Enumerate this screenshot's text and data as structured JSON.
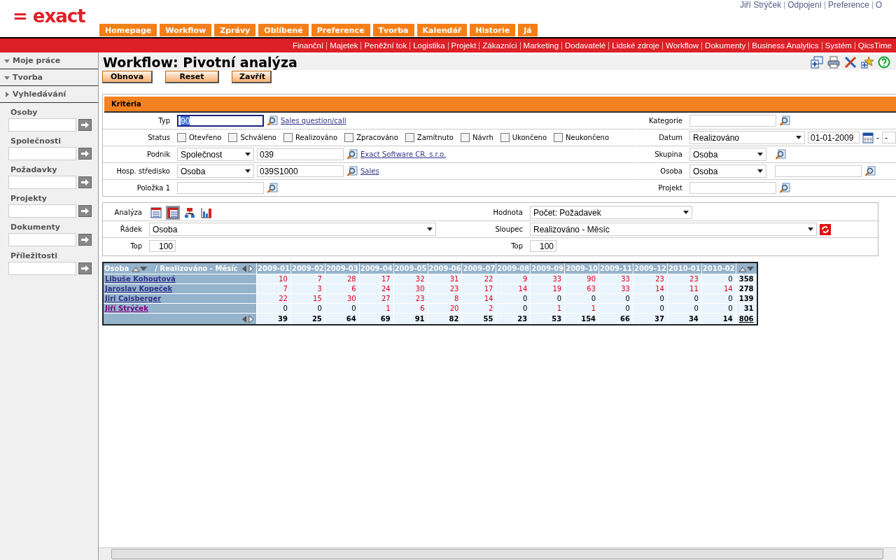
{
  "logo": "= exact",
  "user_links": [
    "Jiří Strýček",
    "Odpojení",
    "Preference",
    "O"
  ],
  "main_tabs": [
    {
      "label": "Homepage",
      "selected": false
    },
    {
      "label": "Workflow",
      "selected": false
    },
    {
      "label": "Zprávy",
      "selected": false
    },
    {
      "label": "Oblíbené",
      "selected": false
    },
    {
      "label": "Preference",
      "selected": false
    },
    {
      "label": "Tvorba",
      "selected": false
    },
    {
      "label": "Kalendář",
      "selected": false
    },
    {
      "label": "Historie",
      "selected": false
    },
    {
      "label": "Já",
      "selected": false
    }
  ],
  "module_links": [
    "Finanční",
    "Majetek",
    "Peněžní tok",
    "Logistika",
    "Projekt",
    "Zákazníci",
    "Marketing",
    "Dodavatelé",
    "Lidské zdroje",
    "Workflow",
    "Dokumenty",
    "Business Analytics",
    "Systém",
    "QicsTime"
  ],
  "sidebar": {
    "sections": [
      {
        "label": "Moje práce",
        "expanded": true
      },
      {
        "label": "Tvorba",
        "expanded": true
      },
      {
        "label": "Vyhledávání",
        "expanded": false
      }
    ],
    "searches": [
      "Osoby",
      "Společnosti",
      "Požadavky",
      "Projekty",
      "Dokumenty",
      "Příležitosti"
    ]
  },
  "page_title": "Workflow: Pivotní analýza",
  "buttons": [
    "Obnova",
    "Reset",
    "Zavřít"
  ],
  "criteria": {
    "title": "Kritéria",
    "typ": {
      "label": "Typ",
      "value": "90",
      "link": "Sales question/call"
    },
    "status": {
      "label": "Status",
      "options": [
        {
          "label": "Otevřeno",
          "checked": false
        },
        {
          "label": "Schváleno",
          "checked": false
        },
        {
          "label": "Realizováno",
          "checked": false
        },
        {
          "label": "Zpracováno",
          "checked": false
        },
        {
          "label": "Zamítnuto",
          "checked": false
        },
        {
          "label": "Návrh",
          "checked": false
        },
        {
          "label": "Ukončeno",
          "checked": false
        },
        {
          "label": "Neukončeno",
          "checked": false
        }
      ]
    },
    "podnik": {
      "label": "Podnik",
      "select": "Společnost",
      "value": "039",
      "link": "Exact Software CR. s.r.o."
    },
    "stredisko": {
      "label": "Hosp. středisko",
      "select": "Osoba",
      "value": "039S1000",
      "link": "Sales"
    },
    "polozka": {
      "label": "Položka 1"
    },
    "kategorie": {
      "label": "Kategorie"
    },
    "datum": {
      "label": "Datum",
      "select": "Realizováno",
      "from": "01-01-2009",
      "separator": "-",
      "to": "-"
    },
    "skupina": {
      "label": "Skupina",
      "select": "Osoba"
    },
    "osoba": {
      "label": "Osoba",
      "select": "Osoba"
    },
    "projekt": {
      "label": "Projekt"
    }
  },
  "analysis": {
    "label": "Analýza",
    "views": [
      {
        "kind": "table",
        "selected": false
      },
      {
        "kind": "grid",
        "selected": true
      },
      {
        "kind": "tree",
        "selected": false
      },
      {
        "kind": "chart",
        "selected": false
      }
    ],
    "radek": {
      "label": "Řádek",
      "select": "Osoba"
    },
    "top_left": {
      "label": "Top",
      "value": "100"
    },
    "hodnota": {
      "label": "Hodnota",
      "select": "Počet: Požadavek"
    },
    "sloupec": {
      "label": "Sloupec",
      "select": "Realizováno - Měsíc"
    },
    "top_right": {
      "label": "Top",
      "value": "100"
    }
  },
  "pivot": {
    "row_header": "Osoba",
    "col_header": "/ Realizováno - Měsíc",
    "columns": [
      "2009-01",
      "2009-02",
      "2009-03",
      "2009-04",
      "2009-05",
      "2009-06",
      "2009-07",
      "2009-08",
      "2009-09",
      "2009-10",
      "2009-11",
      "2009-12",
      "2010-01",
      "2010-02"
    ],
    "rows": [
      {
        "name": "Libuše Kohoutová",
        "visited": false,
        "values": [
          "10",
          "7",
          "28",
          "17",
          "32",
          "31",
          "22",
          "9",
          "33",
          "90",
          "33",
          "23",
          "23",
          "0"
        ],
        "highlighted": [
          true,
          true,
          true,
          true,
          true,
          true,
          true,
          true,
          true,
          true,
          true,
          true,
          true,
          false
        ],
        "total": "358"
      },
      {
        "name": "Jaroslav Kopeček",
        "visited": false,
        "values": [
          "7",
          "3",
          "6",
          "24",
          "30",
          "23",
          "17",
          "14",
          "19",
          "63",
          "33",
          "14",
          "11",
          "14"
        ],
        "highlighted": [
          true,
          true,
          true,
          true,
          true,
          true,
          true,
          true,
          true,
          true,
          true,
          true,
          true,
          true
        ],
        "total": "278"
      },
      {
        "name": "Jiri Caisberger",
        "visited": false,
        "values": [
          "22",
          "15",
          "30",
          "27",
          "23",
          "8",
          "14",
          "0",
          "0",
          "0",
          "0",
          "0",
          "0",
          "0"
        ],
        "highlighted": [
          true,
          true,
          true,
          true,
          true,
          true,
          true,
          false,
          false,
          false,
          false,
          false,
          false,
          false
        ],
        "total": "139"
      },
      {
        "name": "Jiří Strýček",
        "visited": true,
        "values": [
          "0",
          "0",
          "0",
          "1",
          "6",
          "20",
          "2",
          "0",
          "1",
          "1",
          "0",
          "0",
          "0",
          "0"
        ],
        "highlighted": [
          false,
          false,
          false,
          true,
          true,
          true,
          true,
          false,
          true,
          true,
          false,
          false,
          false,
          false
        ],
        "total": "31"
      }
    ],
    "totals": [
      "39",
      "25",
      "64",
      "69",
      "91",
      "82",
      "55",
      "23",
      "53",
      "154",
      "66",
      "37",
      "34",
      "14"
    ],
    "grand_total": "806"
  }
}
